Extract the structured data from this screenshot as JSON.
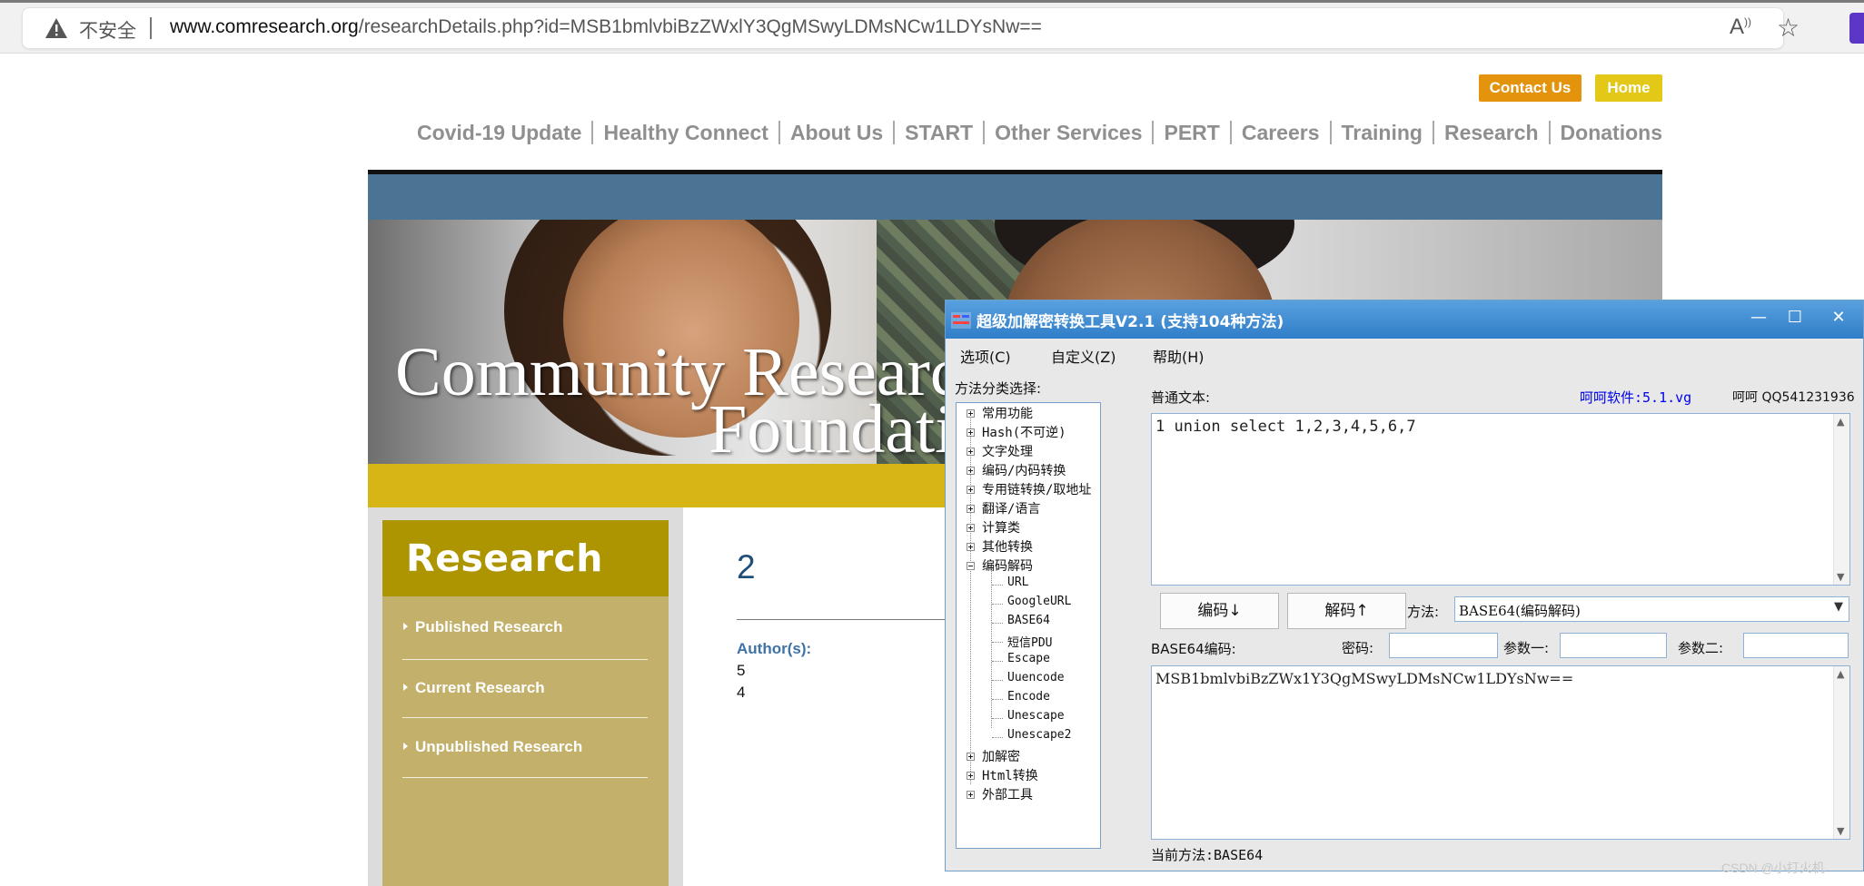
{
  "browser": {
    "insecure_label": "不安全",
    "url_host": "www.comresearch.org",
    "url_path": "/researchDetails.php?id=MSB1bmlvbiBzZWxlY3QgMSwyLDMsNCw1LDYsNw=="
  },
  "site": {
    "top_buttons": {
      "contact": "Contact Us",
      "home": "Home"
    },
    "nav": [
      "Covid-19 Update",
      "Healthy Connect",
      "About Us",
      "START",
      "Other Services",
      "PERT",
      "Careers",
      "Training",
      "Research",
      "Donations"
    ],
    "hero": {
      "line1": "Community Researc",
      "line2": "Foundati"
    },
    "sidebar": {
      "title": "Research",
      "links": [
        "Published Research",
        "Current Research",
        "Unpublished Research"
      ]
    },
    "content": {
      "heading": "2",
      "authors_label": "Author(s):",
      "authors": [
        "5",
        "4"
      ]
    }
  },
  "tool": {
    "title": "超级加解密转换工具V2.1 (支持104种方法)",
    "menu": [
      "选项(C)",
      "自定义(Z)",
      "帮助(H)"
    ],
    "tree_label": "方法分类选择:",
    "tree_top": [
      "常用功能",
      "Hash(不可逆)",
      "文字处理",
      "编码/内码转换",
      "专用链转换/取地址",
      "翻译/语言",
      "计算类",
      "其他转换",
      "编码解码"
    ],
    "tree_children": [
      "URL",
      "GoogleURL",
      "BASE64",
      "短信PDU",
      "Escape",
      "Uuencode",
      "Encode",
      "Unescape",
      "Unescape2"
    ],
    "tree_bottom": [
      "加解密",
      "Html转换",
      "外部工具"
    ],
    "plain_label": "普通文本:",
    "brand": "呵呵软件:5.1.vg",
    "contact": "呵呵 QQ541231936",
    "plain_text": "1 union select 1,2,3,4,5,6,7",
    "encode_button": "编码↓",
    "decode_button": "解码↑",
    "method_label": "方法:",
    "method_value": "BASE64(编码解码)",
    "encoded_label": "BASE64编码:",
    "password_label": "密码:",
    "param1_label": "参数一:",
    "param2_label": "参数二:",
    "encoded_text": "MSB1bmlvbiBzZWx1Y3QgMSwyLDMsNCw1LDYsNw==",
    "status": "当前方法:BASE64"
  },
  "watermark": "CSDN @小打火机"
}
